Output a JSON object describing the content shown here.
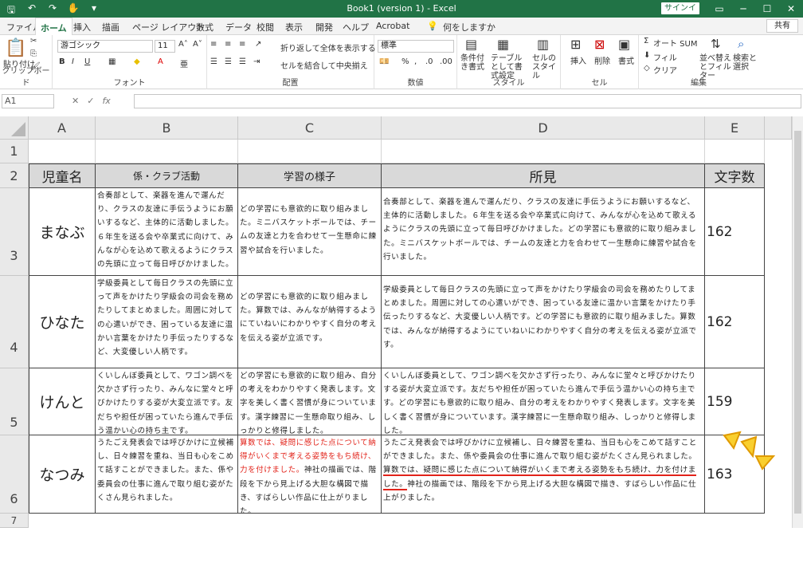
{
  "titlebar": {
    "title": "Book1 (version 1) - Excel",
    "signin": "サインイン",
    "qat": [
      "save",
      "undo",
      "redo",
      "touch",
      "customize"
    ]
  },
  "tabs": [
    "ファイル",
    "ホーム",
    "挿入",
    "描画",
    "ページ レイアウト",
    "数式",
    "データ",
    "校閲",
    "表示",
    "開発",
    "ヘルプ",
    "Acrobat",
    "何をしますか"
  ],
  "share": "共有",
  "ribbon": {
    "clipboard": {
      "label": "クリップボード",
      "paste": "貼り付け"
    },
    "font": {
      "label": "フォント",
      "name": "游ゴシック",
      "size": "11"
    },
    "align": {
      "label": "配置",
      "wrap": "折り返して全体を表示する",
      "merge": "セルを結合して中央揃え"
    },
    "number": {
      "label": "数値",
      "format": "標準"
    },
    "style": {
      "label": "スタイル",
      "cond": "条件付き書式",
      "table": "テーブルとして書式設定",
      "cell": "セルのスタイル"
    },
    "cells": {
      "label": "セル",
      "insert": "挿入",
      "delete": "削除",
      "format": "書式"
    },
    "edit": {
      "label": "編集",
      "autosum": "オート SUM",
      "fill": "フィル",
      "clear": "クリア",
      "sort": "並べ替えとフィルター",
      "find": "検索と選択"
    }
  },
  "formula": {
    "namebox": "A1",
    "fx": "fx"
  },
  "columns": [
    "A",
    "B",
    "C",
    "D",
    "E"
  ],
  "rows": [
    "1",
    "2",
    "3",
    "4",
    "5",
    "6",
    "7"
  ],
  "headers": {
    "a": "児童名",
    "b": "係・クラブ活動",
    "c": "学習の様子",
    "d": "所見",
    "e": "文字数"
  },
  "students": [
    {
      "name": "まなぶ",
      "b": "合奏部として、楽器を進んで運んだり、クラスの友達に手伝うようにお願いするなど、主体的に活動しました。６年生を送る会や卒業式に向けて、みんなが心を込めて歌えるようにクラスの先頭に立って毎日呼びかけました。",
      "c": "どの学習にも意欲的に取り組みました。ミニバスケットボールでは、チームの友達と力を合わせて一生懸命に練習や試合を行いました。",
      "d": "合奏部として、楽器を進んで運んだり、クラスの友達に手伝うようにお願いするなど、主体的に活動しました。６年生を送る会や卒業式に向けて、みんなが心を込めて歌えるようにクラスの先頭に立って毎日呼びかけました。どの学習にも意欲的に取り組みました。ミニバスケットボールでは、チームの友達と力を合わせて一生懸命に練習や試合を行いました。",
      "e": "162"
    },
    {
      "name": "ひなた",
      "b": "学級委員として毎日クラスの先頭に立って声をかけたり学級会の司会を務めたりしてまとめました。周囲に対しての心遣いができ、困っている友達に温かい言葉をかけたり手伝ったりするなど、大変優しい人柄です。",
      "c": "どの学習にも意欲的に取り組みました。算数では、みんなが納得するようにていねいにわかりやすく自分の考えを伝える姿が立派です。",
      "d": "学級委員として毎日クラスの先頭に立って声をかけたり学級会の司会を務めたりしてまとめました。周囲に対しての心遣いができ、困っている友達に温かい言葉をかけたり手伝ったりするなど、大変優しい人柄です。どの学習にも意欲的に取り組みました。算数では、みんなが納得するようにていねいにわかりやすく自分の考えを伝える姿が立派です。",
      "e": "162"
    },
    {
      "name": "けんと",
      "b": "くいしんぼ委員として、ワゴン調べを欠かさず行ったり、みんなに堂々と呼びかけたりする姿が大変立派です。友だちや担任が困っていたら進んで手伝う温かい心の持ち主です。",
      "c": "どの学習にも意欲的に取り組み、自分の考えをわかりやすく発表します。文字を美しく書く習慣が身についています。漢字練習に一生懸命取り組み、しっかりと修得しました。",
      "d": "くいしんぼ委員として、ワゴン調べを欠かさず行ったり、みんなに堂々と呼びかけたりする姿が大変立派です。友だちや担任が困っていたら進んで手伝う温かい心の持ち主です。どの学習にも意欲的に取り組み、自分の考えをわかりやすく発表します。文字を美しく書く習慣が身についています。漢字練習に一生懸命取り組み、しっかりと修得しました。",
      "e": "159"
    },
    {
      "name": "なつみ",
      "b": "うたごえ発表会では呼びかけに立候補し、日々練習を重ね、当日も心をこめて話すことができました。また、係や委員会の仕事に進んで取り組む姿がたくさん見られました。",
      "c_red": "算数では、疑問に感じた点について納得がいくまで考える姿勢をもち続け、力を付けました。",
      "c_rest": "神社の描画では、階段を下から見上げる大胆な構図で描き、すばらしい作品に仕上がりました。",
      "d_start": "うたごえ発表会では呼びかけに立候補し、日々練習を重ね、当日も心をこめて話すことができました。また、係や委員会の仕事に進んで取り組む姿がたくさん見られました。",
      "d_ul": "算数では、疑問に感じた点について納得がいくまで考える姿勢をもち続け、力を付けました。",
      "d_end": "神社の描画では、階段を下から見上げる大胆な構図で描き、すばらしい作品に仕上がりました。",
      "e": "163"
    }
  ]
}
